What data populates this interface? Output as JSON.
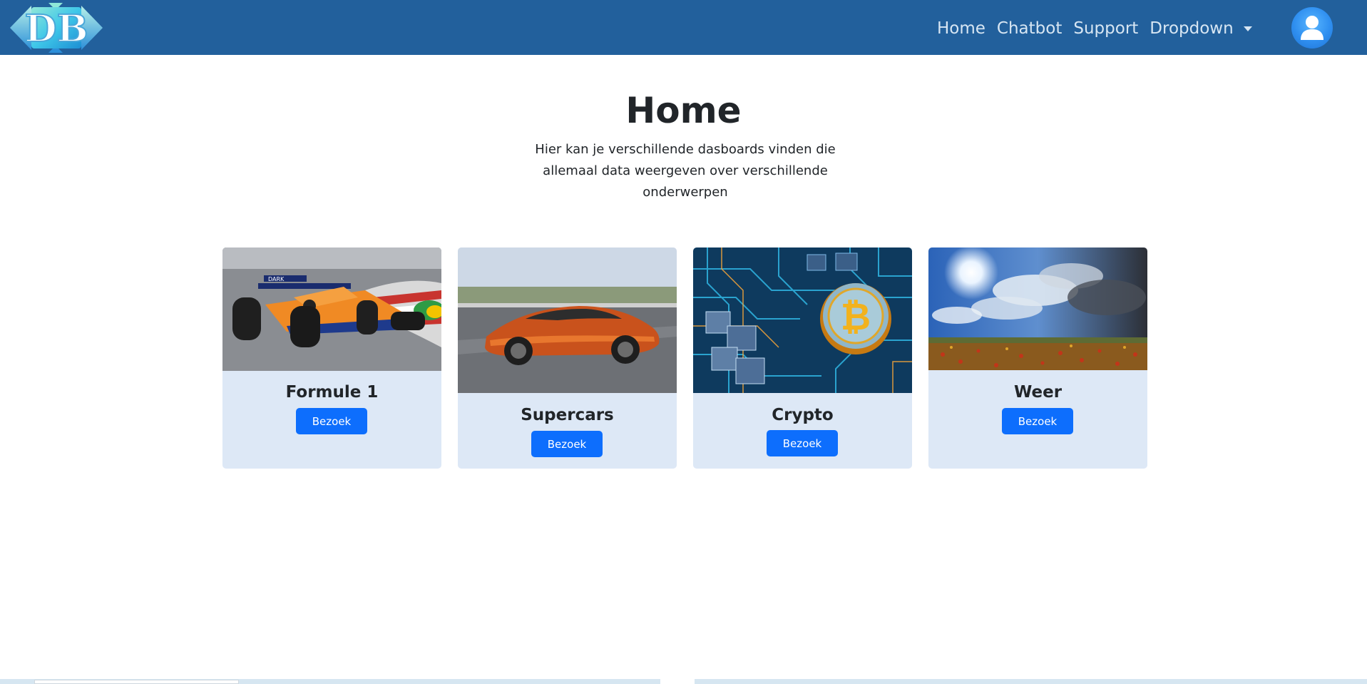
{
  "navbar": {
    "logo_text": "DB",
    "links": [
      "Home",
      "Chatbot",
      "Support"
    ],
    "dropdown_label": "Dropdown",
    "colors": {
      "background": "#22609c",
      "link": "#d7e6f3"
    }
  },
  "header": {
    "title": "Home",
    "subtitle": "Hier kan je verschillende dasboards vinden die allemaal data weergeven over verschillende onderwerpen"
  },
  "cards": [
    {
      "title": "Formule 1",
      "button": "Bezoek",
      "image": "formula-one-car"
    },
    {
      "title": "Supercars",
      "button": "Bezoek",
      "image": "orange-supercar"
    },
    {
      "title": "Crypto",
      "button": "Bezoek",
      "image": "bitcoin-circuit"
    },
    {
      "title": "Weer",
      "button": "Bezoek",
      "image": "sky-field"
    }
  ],
  "colors": {
    "card_bg": "#dde8f6",
    "button": "#0d6efd"
  }
}
